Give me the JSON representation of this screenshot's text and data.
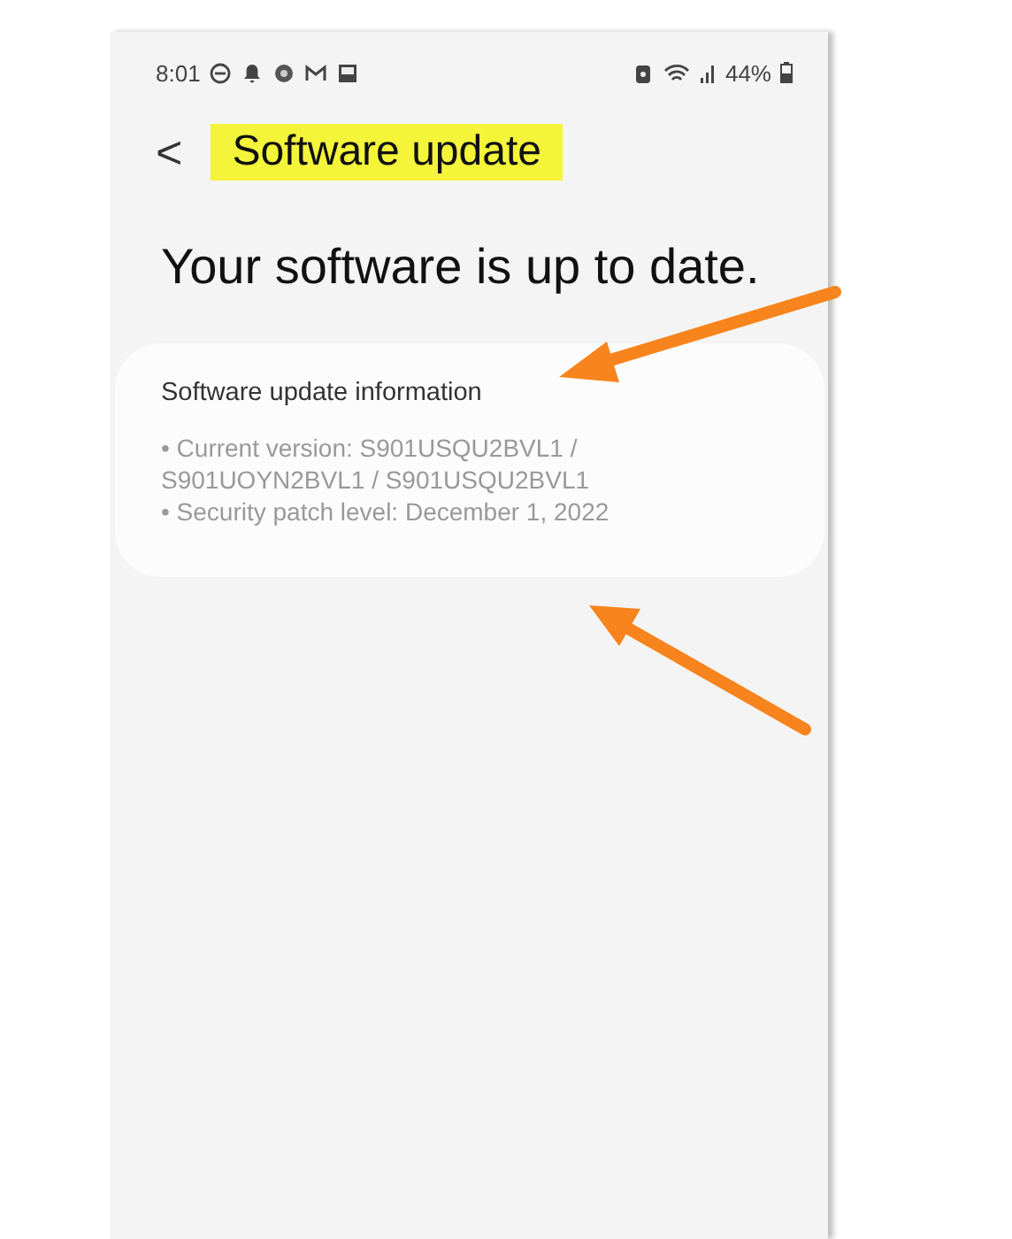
{
  "status_bar": {
    "time": "8:01",
    "battery": "44%"
  },
  "header": {
    "back": "<",
    "title": "Software update"
  },
  "headline": "Your software is up to date.",
  "info_card": {
    "title": "Software update information",
    "items": [
      "• Current version: S901USQU2BVL1 / S901UOYN2BVL1 / S901USQU2BVL1",
      "• Security patch level: December 1, 2022"
    ]
  }
}
